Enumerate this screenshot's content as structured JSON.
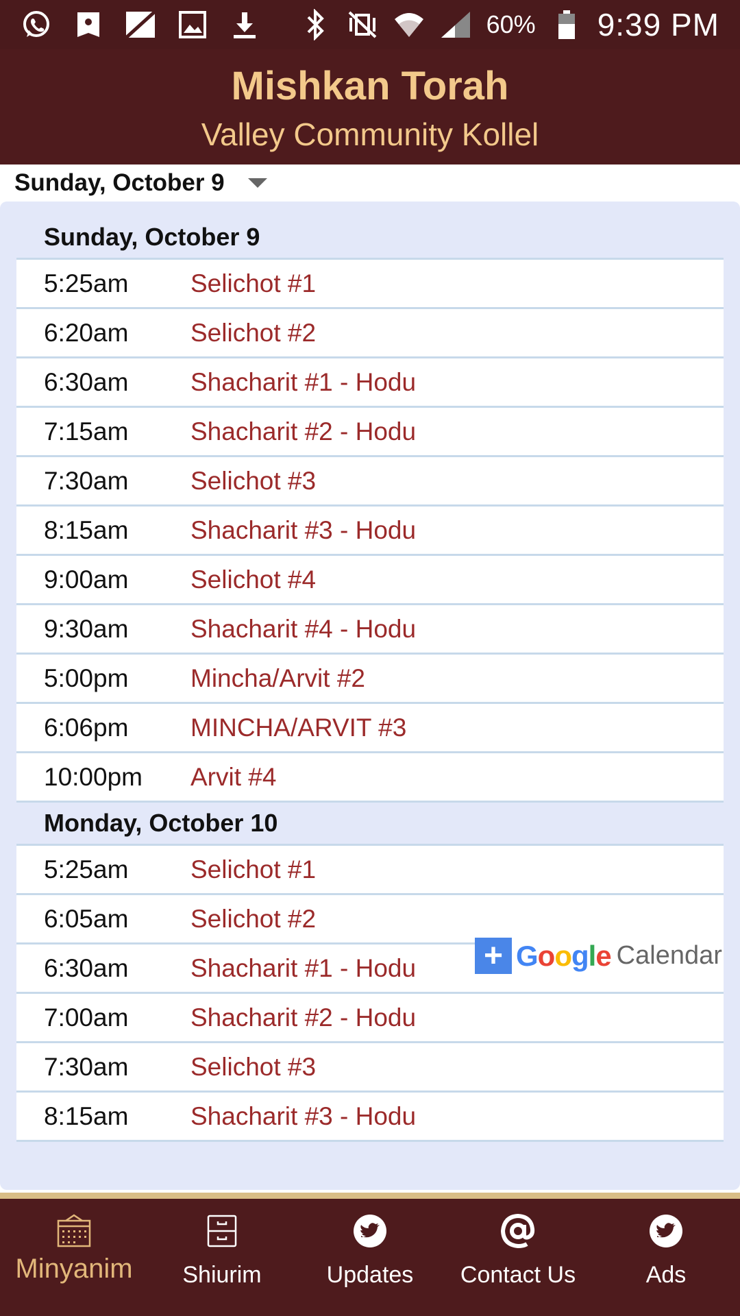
{
  "status_bar": {
    "left_icons": [
      "whatsapp-icon",
      "bookmark-icon",
      "signal-slash-icon",
      "gallery-icon",
      "download-icon"
    ],
    "right_icons": [
      "bluetooth-icon",
      "vibrate-mute-icon",
      "wifi-icon",
      "cell-signal-icon"
    ],
    "battery_percent": "60%",
    "battery_level": 0.6,
    "time": "9:39 PM"
  },
  "header": {
    "title": "Mishkan Torah",
    "subtitle": "Valley Community Kollel"
  },
  "date_selector": {
    "value": "Sunday, October 9"
  },
  "schedule": {
    "days": [
      {
        "date": "Sunday, October 9",
        "items": [
          {
            "time": "5:25am",
            "name": "Selichot #1"
          },
          {
            "time": "6:20am",
            "name": "Selichot #2"
          },
          {
            "time": "6:30am",
            "name": "Shacharit #1 - Hodu"
          },
          {
            "time": "7:15am",
            "name": "Shacharit #2 - Hodu"
          },
          {
            "time": "7:30am",
            "name": "Selichot #3"
          },
          {
            "time": "8:15am",
            "name": "Shacharit #3 - Hodu"
          },
          {
            "time": "9:00am",
            "name": "Selichot #4"
          },
          {
            "time": "9:30am",
            "name": "Shacharit #4 - Hodu"
          },
          {
            "time": "5:00pm",
            "name": "Mincha/Arvit #2"
          },
          {
            "time": "6:06pm",
            "name": "MINCHA/ARVIT #3"
          },
          {
            "time": "10:00pm",
            "name": "Arvit #4"
          }
        ]
      },
      {
        "date": "Monday, October 10",
        "items": [
          {
            "time": "5:25am",
            "name": "Selichot #1"
          },
          {
            "time": "6:05am",
            "name": "Selichot #2"
          },
          {
            "time": "6:30am",
            "name": "Shacharit #1 - Hodu"
          },
          {
            "time": "7:00am",
            "name": "Shacharit #2 - Hodu"
          },
          {
            "time": "7:30am",
            "name": "Selichot #3"
          },
          {
            "time": "8:15am",
            "name": "Shacharit #3 - Hodu"
          }
        ]
      }
    ]
  },
  "google_calendar": {
    "plus": "+",
    "google": "Google",
    "calendar": "Calendar"
  },
  "bottom_nav": {
    "items": [
      {
        "label": "Minyanim",
        "icon": "calendar-icon",
        "active": true
      },
      {
        "label": "Shiurim",
        "icon": "cabinet-icon",
        "active": false
      },
      {
        "label": "Updates",
        "icon": "twitter-icon",
        "active": false
      },
      {
        "label": "Contact Us",
        "icon": "at-sign-icon",
        "active": false
      },
      {
        "label": "Ads",
        "icon": "twitter-icon",
        "active": false
      }
    ]
  },
  "colors": {
    "header_bg": "#4e1b1d",
    "title_gold": "#f3c98b",
    "item_red": "#9b2a2a",
    "panel_bg": "#e3e8f9",
    "nav_active": "#e2b77a"
  }
}
